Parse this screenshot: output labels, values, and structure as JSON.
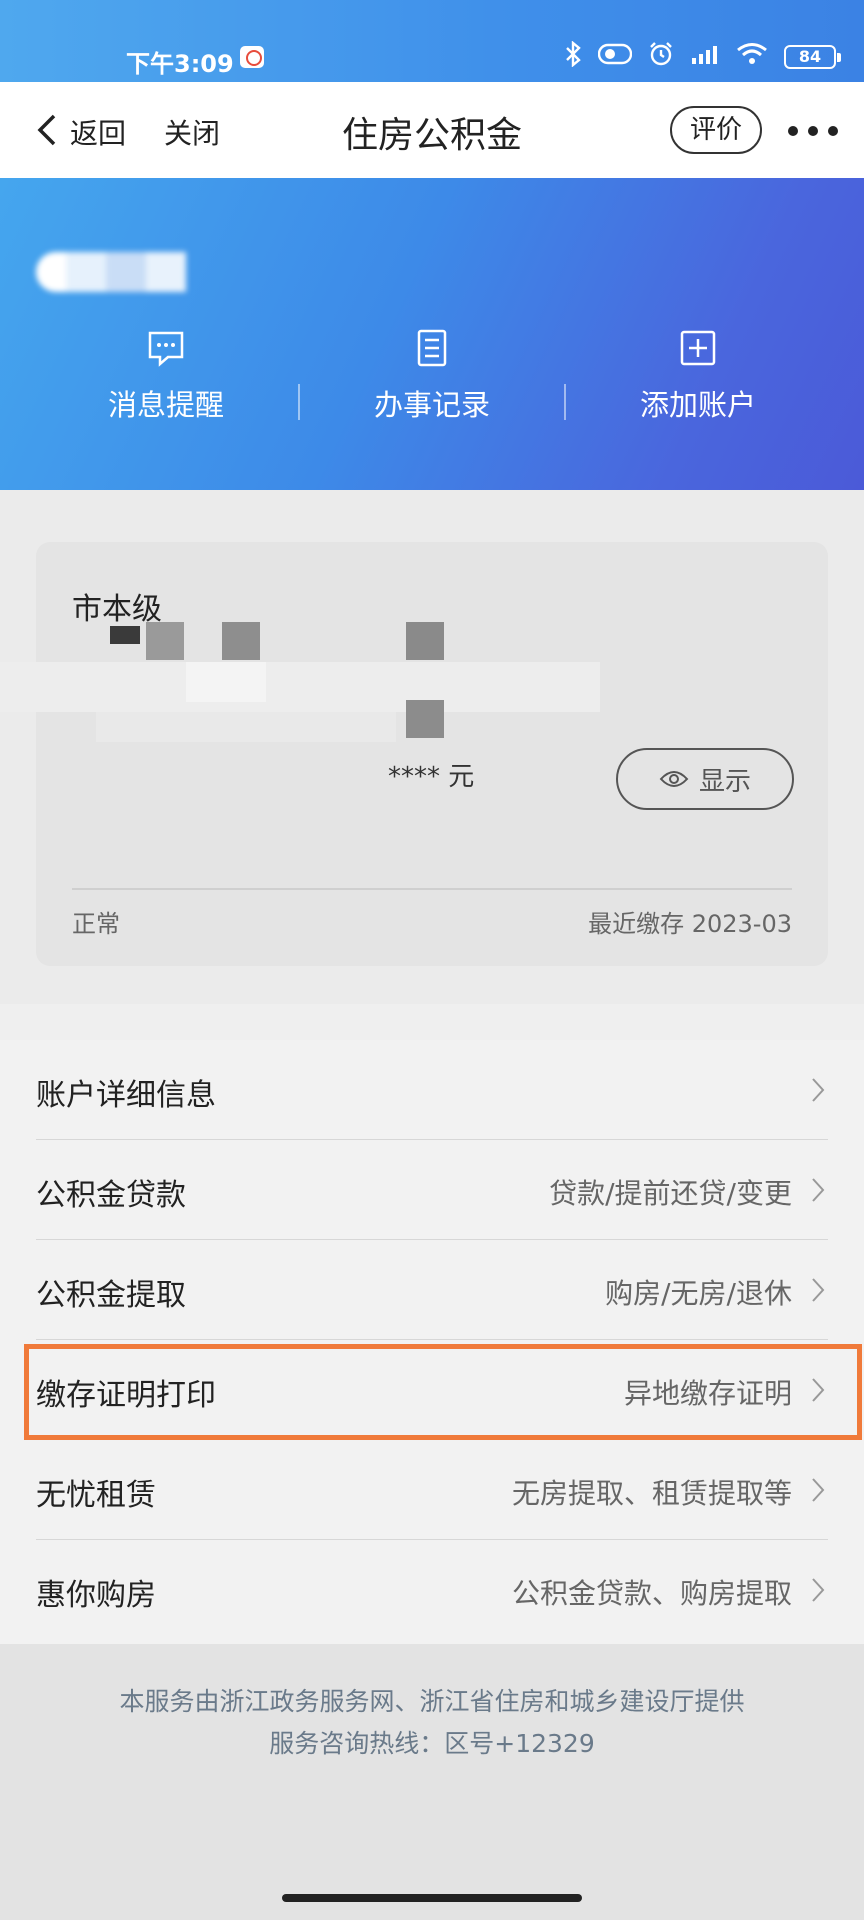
{
  "status_bar": {
    "time": "下午3:09",
    "battery": "84"
  },
  "nav": {
    "back": "返回",
    "close": "关闭",
    "title": "住房公积金",
    "rate": "评价"
  },
  "hero": {
    "actions": [
      {
        "label": "消息提醒",
        "icon": "message-icon"
      },
      {
        "label": "办事记录",
        "icon": "record-icon"
      },
      {
        "label": "添加账户",
        "icon": "add-account-icon"
      }
    ]
  },
  "card": {
    "city": "市本级",
    "amount": "**** 元",
    "show_label": "显示",
    "status": "正常",
    "recent": "最近缴存 2023-03"
  },
  "menu": [
    {
      "label": "账户详细信息",
      "value": ""
    },
    {
      "label": "公积金贷款",
      "value": "贷款/提前还贷/变更"
    },
    {
      "label": "公积金提取",
      "value": "购房/无房/退休"
    },
    {
      "label": "缴存证明打印",
      "value": "异地缴存证明"
    },
    {
      "label": "无忧租赁",
      "value": "无房提取、租赁提取等"
    },
    {
      "label": "惠你购房",
      "value": "公积金贷款、购房提取"
    }
  ],
  "footer": {
    "line1": "本服务由浙江政务服务网、浙江省住房和城乡建设厅提供",
    "line2": "服务咨询热线：区号+12329"
  },
  "colors": {
    "accent": "#3d8ae8",
    "highlight": "#f07a3a"
  }
}
